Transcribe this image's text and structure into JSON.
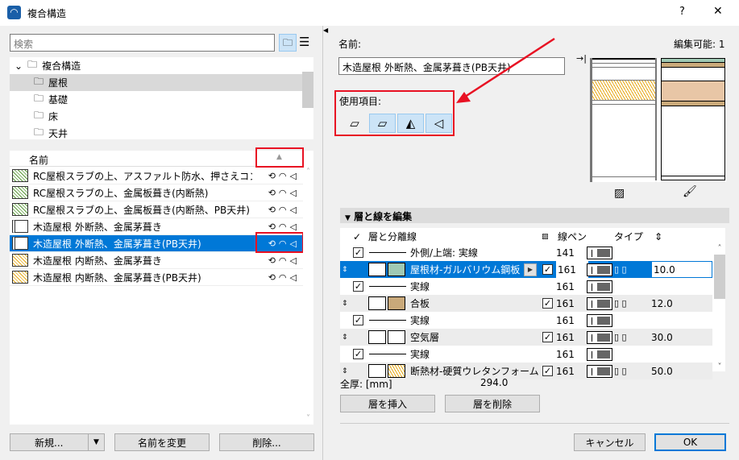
{
  "window": {
    "title": "複合構造",
    "help": "?",
    "close": "✕"
  },
  "left": {
    "search_placeholder": "検索",
    "tree": [
      {
        "label": "複合構造",
        "level": 0
      },
      {
        "label": "屋根",
        "level": 1,
        "selected": true
      },
      {
        "label": "基礎",
        "level": 1
      },
      {
        "label": "床",
        "level": 1
      },
      {
        "label": "天井",
        "level": 1
      }
    ],
    "list_header": "名前",
    "items": [
      {
        "name": "RC屋根スラブの上、アスファルト防水、押さえコン",
        "icons": "⟲◠◁"
      },
      {
        "name": "RC屋根スラブの上、金属板葺き(内断熱)",
        "icons": "⟲◠◁"
      },
      {
        "name": "RC屋根スラブの上、金属板葺き(内断熱、PB天井)",
        "icons": "⟲◠◁"
      },
      {
        "name": "木造屋根 外断熱、金属茅葺き",
        "icons": "⟲◠◁"
      },
      {
        "name": "木造屋根 外断熱、金属茅葺き(PB天井)",
        "icons": "⟲◠◁",
        "selected": true
      },
      {
        "name": "木造屋根 内断熱、金属茅葺き",
        "icons": "⟲◠◁"
      },
      {
        "name": "木造屋根 内断熱、金属茅葺き(PB天井)",
        "icons": "⟲◠◁"
      }
    ],
    "buttons": {
      "new": "新規...",
      "rename": "名前を変更",
      "delete": "削除..."
    }
  },
  "right": {
    "name_label": "名前:",
    "editable": "編集可能: 1",
    "name_value": "木造屋根 外断熱、金属茅葺き(PB天井)",
    "usage_label": "使用項目:",
    "section_title": "層と線を編集",
    "columns": {
      "check": "✓",
      "name": "層と分離線",
      "pen": "線ペン",
      "type": "タイプ",
      "thickness": "⇕"
    },
    "layers": [
      {
        "kind": "line",
        "checked": true,
        "name": "外側/上端: 実線",
        "pen": "141"
      },
      {
        "kind": "layer",
        "name": "屋根材-ガルバリウム鋼板",
        "fill": "#9fc9b4",
        "checked": true,
        "pen": "161",
        "thickness": "10.0",
        "selected": true
      },
      {
        "kind": "line",
        "checked": true,
        "name": "実線",
        "pen": "161"
      },
      {
        "kind": "layer",
        "name": "合板",
        "fill": "#c9a97a",
        "checked": true,
        "pen": "161",
        "thickness": "12.0"
      },
      {
        "kind": "line",
        "checked": true,
        "name": "実線",
        "pen": "161"
      },
      {
        "kind": "layer",
        "name": "空気層",
        "fill": "#ffffff",
        "checked": true,
        "pen": "161",
        "thickness": "30.0"
      },
      {
        "kind": "line",
        "checked": true,
        "name": "実線",
        "pen": "161"
      },
      {
        "kind": "layer",
        "name": "断熱材-硬質ウレタンフォーム",
        "fill": "#e8c6a6",
        "checked": true,
        "pen": "161",
        "thickness": "50.0"
      }
    ],
    "total_label": "全厚: [mm]",
    "total_value": "294.0",
    "insert_layer": "層を挿入",
    "delete_layer": "層を削除",
    "cancel": "キャンセル",
    "ok": "OK"
  },
  "colors": {
    "accent": "#0078d7",
    "highlight": "#e81123"
  }
}
